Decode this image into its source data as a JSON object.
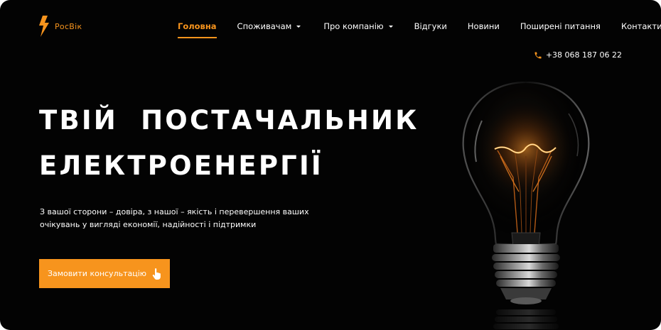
{
  "brand": {
    "name": "РосВік",
    "accent": "#f7941d"
  },
  "nav": {
    "items": [
      {
        "label": "Головна",
        "active": true,
        "dropdown": false
      },
      {
        "label": "Споживачам",
        "active": false,
        "dropdown": true
      },
      {
        "label": "Про компанію",
        "active": false,
        "dropdown": true
      },
      {
        "label": "Відгуки",
        "active": false,
        "dropdown": false
      },
      {
        "label": "Новини",
        "active": false,
        "dropdown": false
      },
      {
        "label": "Поширені питання",
        "active": false,
        "dropdown": false
      },
      {
        "label": "Контакти",
        "active": false,
        "dropdown": false
      }
    ]
  },
  "contact": {
    "phone": "+38 068 187 06 22",
    "icon": "phone-icon"
  },
  "hero": {
    "title_line1": "ТВІЙ  ПОСТАЧАЛЬНИК",
    "title_line2": "ЕЛЕКТРОЕНЕРГІЇ",
    "subtitle_line1": "З вашої сторони – довіра, з нашої – якість і перевершення ваших",
    "subtitle_line2": "очікувань у вигляді економії, надійності і підтримки",
    "cta_label": "Замовити консультацію",
    "cta_icon": "hand-pointer-icon",
    "image": "light-bulb"
  }
}
